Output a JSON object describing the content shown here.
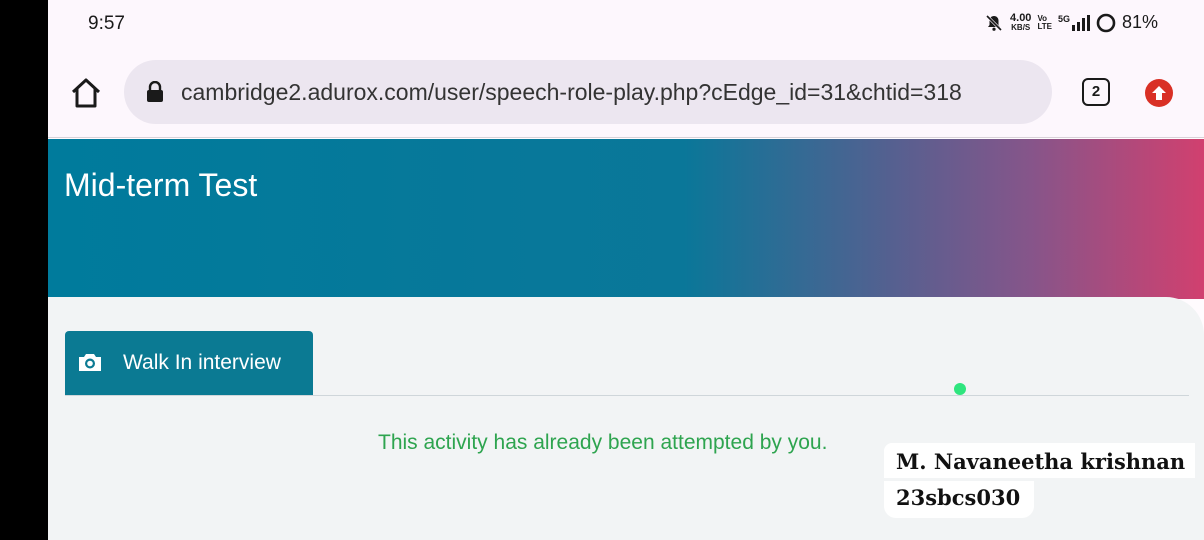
{
  "status_bar": {
    "time": "9:57",
    "net_speed_value": "4.00",
    "net_speed_unit": "KB/S",
    "volte_top": "Vo",
    "volte_bottom": "LTE",
    "network_type": "5G",
    "battery_percent": "81%",
    "icons": [
      "mute-icon",
      "signal-icon",
      "battery-ring-icon"
    ]
  },
  "browser": {
    "url": "cambridge2.adurox.com/user/speech-role-play.php?cEdge_id=31&chtid=318",
    "tab_count": "2",
    "icons": [
      "home-icon",
      "lock-icon",
      "update-icon"
    ]
  },
  "page": {
    "title": "Mid-term Test",
    "tab_label": "Walk In interview",
    "tab_icon": "camera-icon",
    "status_message": "This activity has already been attempted by you."
  },
  "overlay": {
    "name": "M. Navaneetha krishnan",
    "roll_number": "23sbcs030"
  },
  "colors": {
    "header_start": "#007b9c",
    "header_end": "#d1406f",
    "tab_bg": "#0b7a93",
    "message": "#2ea44f",
    "indicator_dot": "#2fe57e"
  }
}
